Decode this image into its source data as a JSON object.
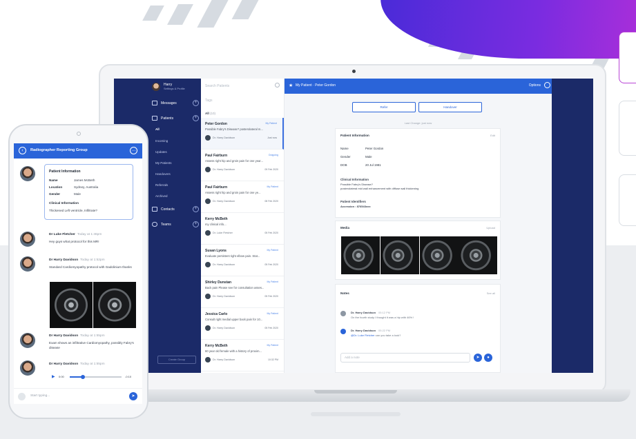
{
  "laptop": {
    "sidebar": {
      "user_name": "Harry",
      "user_sub": "Settings & Profile",
      "messages": "Messages",
      "patients": "Patients",
      "patient_filters": [
        "All",
        "Incoming",
        "Updates",
        "My Patients",
        "Handovers",
        "Referrals",
        "Archived"
      ],
      "contacts": "Contacts",
      "teams": "Teams",
      "bottom_button": "Create Group"
    },
    "list": {
      "search_placeholder": "Search Patients",
      "tags_placeholder": "Tags",
      "filter_all": "All",
      "filter_count": "(10)",
      "patients": [
        {
          "name": "Peter Gordon",
          "tag": "My Patient",
          "desc": "Possible Fabry's Disease? posterolateral m...",
          "doctor": "Dr. Harry Davidson",
          "date": "Just now"
        },
        {
          "name": "Paul Fairburn",
          "tag": "Outgoing",
          "desc": "Assess right hip and groin pain for one year...",
          "doctor": "Dr. Harry Davidson",
          "date": "09 Feb 2020"
        },
        {
          "name": "Paul Fairburn",
          "tag": "My Patient",
          "desc": "Assess right hip and groin pain for one ye...",
          "doctor": "Dr. Harry Davidson",
          "date": "08 Feb 2020"
        },
        {
          "name": "Kerry McBeth",
          "tag": "",
          "desc": "my clinical info...",
          "doctor": "Dr. Luke Fletcher",
          "date": "05 Feb 2020"
        },
        {
          "name": "Susan Lyons",
          "tag": "My Patient",
          "desc": "Evaluate persistent right elbow pain. Stat...",
          "doctor": "Dr. Harry Davidson",
          "date": "05 Feb 2020"
        },
        {
          "name": "Shirley Dunstan",
          "tag": "My Patient",
          "desc": "Back pain Please see for consultation asses...",
          "doctor": "Dr. Harry Davidson",
          "date": "05 Feb 2020"
        },
        {
          "name": "Jessica Carlo",
          "tag": "My Patient",
          "desc": "Consult right medial upper back pain for 10...",
          "doctor": "Dr. Harry Davidson",
          "date": "05 Feb 2020"
        },
        {
          "name": "Kerry McBeth",
          "tag": "My Patient",
          "desc": "60 year old female with a history of proxim...",
          "doctor": "Dr. Harry Davidson",
          "date": "10:32 PM"
        }
      ]
    },
    "detail": {
      "header_title": "My Patient · Peter Gordon",
      "options": "Options",
      "refer_button": "Refer",
      "handover_button": "Handover",
      "last_change": "Last Change: just now",
      "patient_info": {
        "title": "Patient Information",
        "edit": "Edit",
        "name_label": "Name",
        "name_value": "Peter Gordon",
        "gender_label": "Gender",
        "gender_value": "Male",
        "dob_label": "DOB",
        "dob_value": "20 Jul 1981",
        "clinical_title": "Clinical Information",
        "clinical_line1": "Possible Fabry's Disease?",
        "clinical_line2": "posterolateral mid wall enhancement with diffuse wall thickening",
        "identifiers_title": "Patient Identifiers",
        "accession": "Accession : 876543xxx"
      },
      "media": {
        "title": "Media",
        "action": "Upload"
      },
      "notes": {
        "title": "Notes",
        "action": "See all",
        "items": [
          {
            "name": "Dr. Harry Davidson",
            "time": "05:12 PM",
            "text": "On the fourth study I thought it was a hip with 46% !",
            "link": ""
          },
          {
            "name": "Dr. Harry Davidson",
            "time": "05:22 PM",
            "text": "can you take a look?",
            "link": "@Dr. Luke Fletcher"
          }
        ],
        "input_placeholder": "Add a note"
      }
    }
  },
  "phone": {
    "header_title": "Radiographer Reporting Group",
    "card": {
      "title": "Patient Information",
      "name_label": "Name",
      "name_value": "James McBeth",
      "location_label": "Location",
      "location_value": "Sydney, Australia",
      "gender_label": "Gender",
      "gender_value": "Male",
      "clinical_title": "Clinical Information",
      "clinical_value": "Thickened Left ventricle, Infiltrate?"
    },
    "messages": [
      {
        "name": "Dr Luke Fletcher",
        "time": "Today at 1:46pm",
        "text": "Hey guys what protocol for this MR!"
      },
      {
        "name": "Dr Harry Davidson",
        "time": "Today at 1:52pm",
        "text": "Standard Cardiomyopathy protocol with Gadolinium thanks"
      },
      {
        "name": "Dr Harry Davidson",
        "time": "Today at 1:55pm",
        "text": "Exam shows an infiltrative Cardiomyopathy, possibly Fabry's disease"
      },
      {
        "name": "Dr Harry Davidson",
        "time": "Today at 1:55pm",
        "text": ""
      }
    ],
    "audio": {
      "current": "0:00",
      "remaining": "-0:10",
      "progress": 0.25
    },
    "input_placeholder": "Start typing..."
  }
}
